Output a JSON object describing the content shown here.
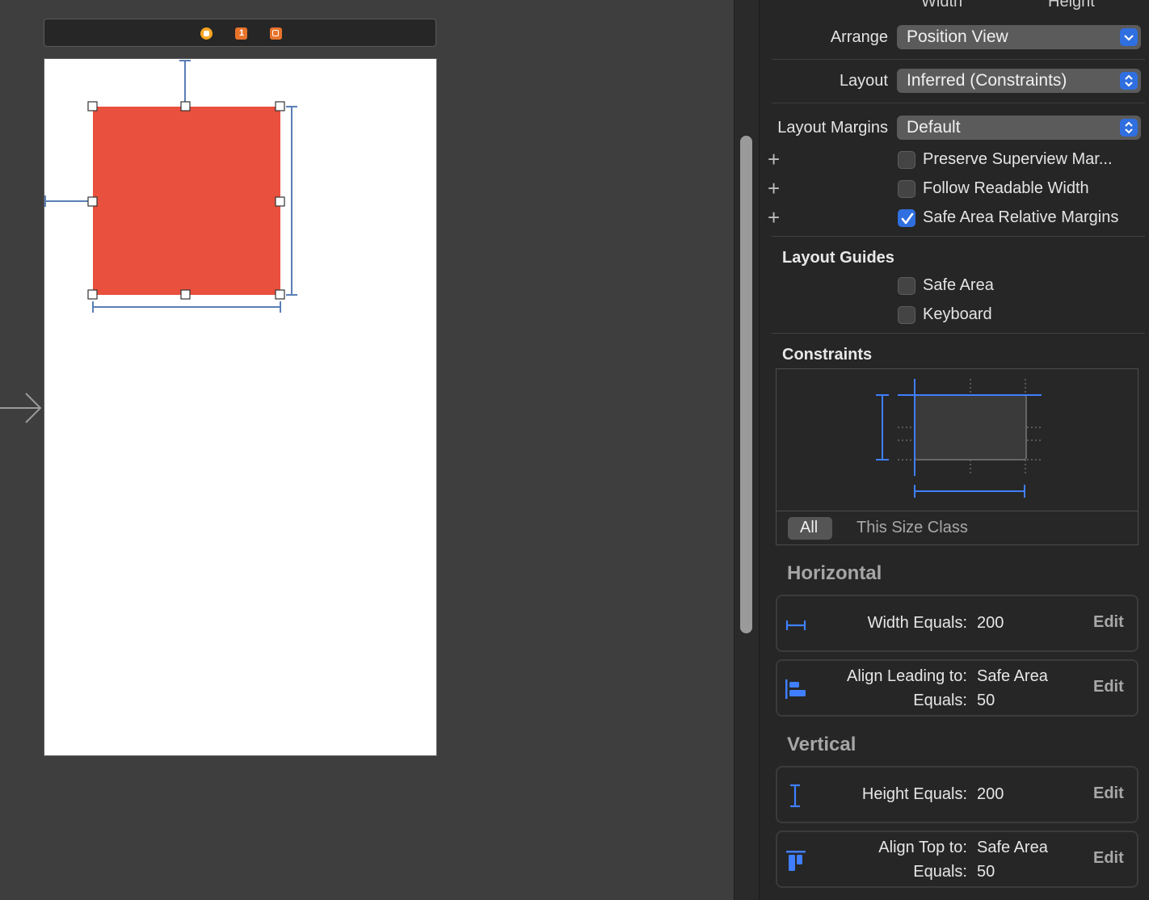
{
  "inspector": {
    "header_partial": {
      "width": "Width",
      "height": "Height"
    },
    "arrange": {
      "label": "Arrange",
      "value": "Position View"
    },
    "layout": {
      "label": "Layout",
      "value": "Inferred (Constraints)"
    },
    "layout_margins": {
      "label": "Layout Margins",
      "value": "Default"
    },
    "options": [
      {
        "label": "Preserve Superview Mar...",
        "checked": false
      },
      {
        "label": "Follow Readable Width",
        "checked": false
      },
      {
        "label": "Safe Area Relative Margins",
        "checked": true
      }
    ],
    "layout_guides": {
      "title": "Layout Guides",
      "items": [
        {
          "label": "Safe Area",
          "checked": false
        },
        {
          "label": "Keyboard",
          "checked": false
        }
      ]
    },
    "constraints": {
      "title": "Constraints",
      "size_class_tabs": [
        "All",
        "This Size Class"
      ],
      "selected_tab": "All"
    },
    "horizontal": {
      "title": "Horizontal",
      "items": [
        {
          "line1_label": "Width Equals:",
          "line1_value": "200",
          "edit": "Edit",
          "icon": "width-icon"
        },
        {
          "line1_label": "Align Leading to:",
          "line1_value": "Safe Area",
          "line2_label": "Equals:",
          "line2_value": "50",
          "edit": "Edit",
          "icon": "align-leading-icon"
        }
      ]
    },
    "vertical": {
      "title": "Vertical",
      "items": [
        {
          "line1_label": "Height Equals:",
          "line1_value": "200",
          "edit": "Edit",
          "icon": "height-icon"
        },
        {
          "line1_label": "Align Top to:",
          "line1_value": "Safe Area",
          "line2_label": "Equals:",
          "line2_value": "50",
          "edit": "Edit",
          "icon": "align-top-icon"
        }
      ]
    }
  },
  "canvas": {
    "selected_view_color": "#E9503D",
    "constraint_color": "#5A7FB5",
    "scene_bar_icons": [
      "view-controller-icon",
      "first-responder-icon",
      "exit-icon"
    ]
  },
  "colors": {
    "accent": "#2F6FE0",
    "inspector_bg": "#262626",
    "canvas_bg": "#3E3E3E"
  }
}
